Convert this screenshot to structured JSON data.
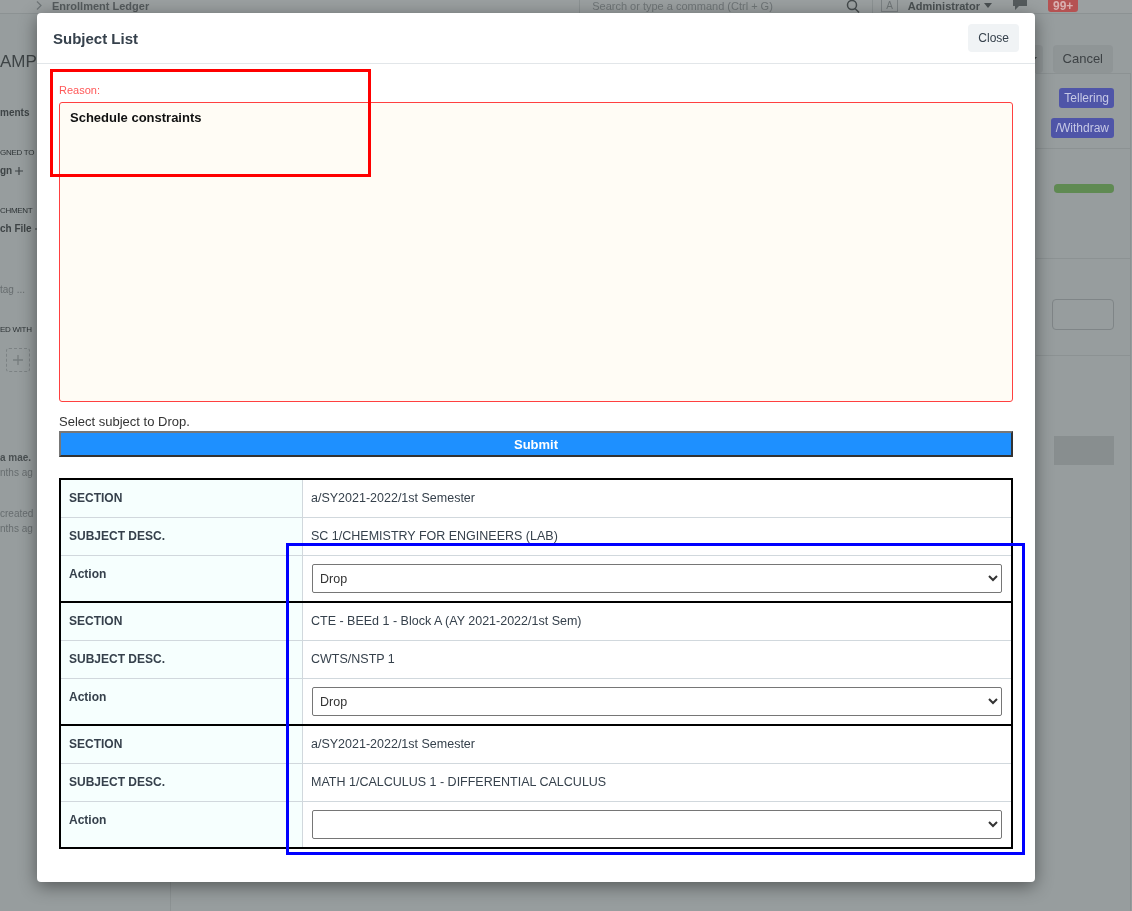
{
  "topbar": {
    "breadcrumb": "Enrollment Ledger",
    "search": {
      "placeholder": "Search or type a command (Ctrl + G)"
    },
    "avatar": "A",
    "user": "Administrator",
    "notifications": "99+"
  },
  "page": {
    "title": "AMP",
    "cancel": "Cancel",
    "badges": [
      "Tellering",
      "/Withdraw"
    ],
    "progress": {
      "level": 1
    }
  },
  "sidebar": {
    "items": [
      {
        "kind": "title",
        "text": "ments"
      },
      {
        "kind": "heading",
        "text": "GNED TO"
      },
      {
        "kind": "link",
        "text": "gn"
      },
      {
        "kind": "heading",
        "text": "CHMENT"
      },
      {
        "kind": "link",
        "text": "ch File"
      },
      {
        "kind": "muted",
        "text": "tag ..."
      },
      {
        "kind": "heading",
        "text": "ED WITH"
      },
      {
        "kind": "add"
      },
      {
        "kind": "name",
        "text": "a mae."
      },
      {
        "kind": "muted",
        "text": "nths ag"
      },
      {
        "kind": "event",
        "text": "created"
      },
      {
        "kind": "muted",
        "text": "nths ag"
      }
    ]
  },
  "modal": {
    "title": "Subject List",
    "close": "Close",
    "reason": {
      "label": "Reason:",
      "value": "Schedule constraints"
    },
    "instruction": "Select subject to Drop.",
    "submit": "Submit",
    "subjects": [
      {
        "section_label": "SECTION",
        "section": "a/SY2021-2022/1st Semester",
        "desc_label": "SUBJECT DESC.",
        "desc": "SC 1/CHEMISTRY FOR ENGINEERS (LAB)",
        "action_label": "Action",
        "action": "Drop"
      },
      {
        "section_label": "SECTION",
        "section": "CTE - BEEd 1 - Block A (AY 2021-2022/1st Sem)",
        "desc_label": "SUBJECT DESC.",
        "desc": "CWTS/NSTP 1",
        "action_label": "Action",
        "action": "Drop"
      },
      {
        "section_label": "SECTION",
        "section": "a/SY2021-2022/1st Semester",
        "desc_label": "SUBJECT DESC.",
        "desc": "MATH 1/CALCULUS 1 - DIFFERENTIAL CALCULUS",
        "action_label": "Action"
      }
    ]
  },
  "annotations": [
    {
      "color": "#ff0000"
    },
    {
      "color": "#0000ff"
    }
  ]
}
